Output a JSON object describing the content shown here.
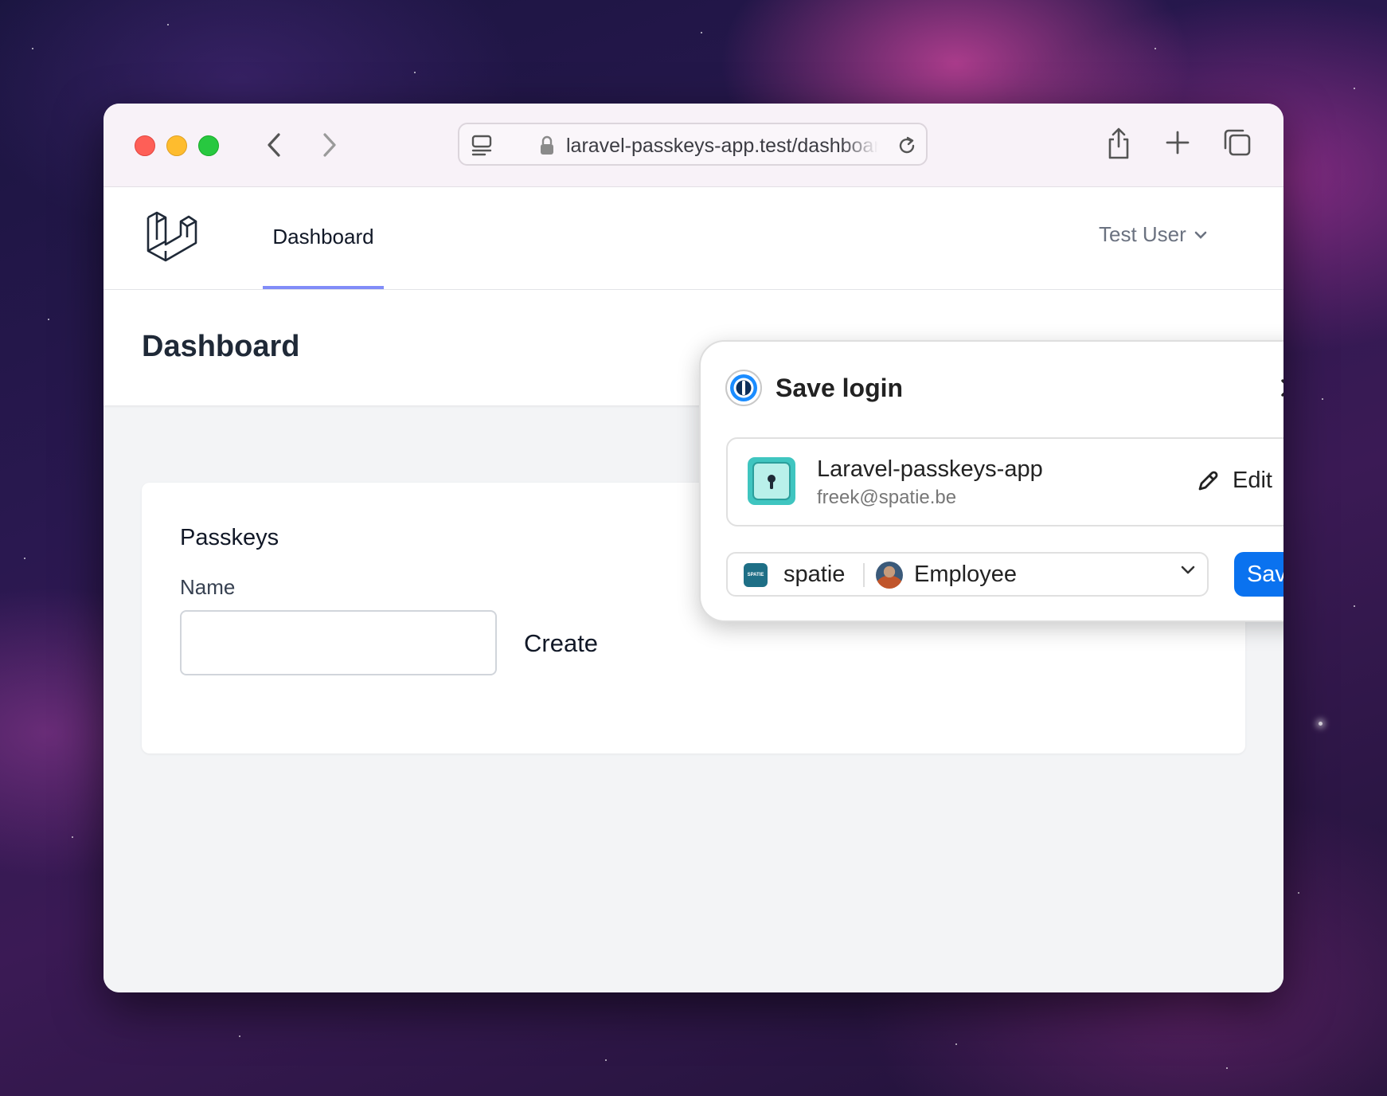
{
  "browser": {
    "url": "laravel-passkeys-app.test/dashboard",
    "icons": [
      "sidebar-icon",
      "lock-icon",
      "reload-icon",
      "share-icon",
      "new-tab-icon",
      "tabs-overview-icon",
      "back-icon",
      "forward-icon"
    ]
  },
  "app": {
    "nav": {
      "dashboard_label": "Dashboard"
    },
    "user_menu": {
      "label": "Test User"
    },
    "header": {
      "title": "Dashboard"
    },
    "passkeys": {
      "title": "Passkeys",
      "name_label": "Name",
      "name_value": "",
      "create_label": "Create"
    }
  },
  "save_login_popup": {
    "title": "Save login",
    "item": {
      "title": "Laravel-passkeys-app",
      "username": "freek@spatie.be",
      "edit_label": "Edit"
    },
    "account": {
      "logo_text": "SPATIE",
      "name": "spatie",
      "vault": "Employee"
    },
    "save_label": "Save"
  },
  "colors": {
    "accent_nav": "#818cf8",
    "save_button": "#0a72ef",
    "page_background": "#f3f4f6"
  }
}
